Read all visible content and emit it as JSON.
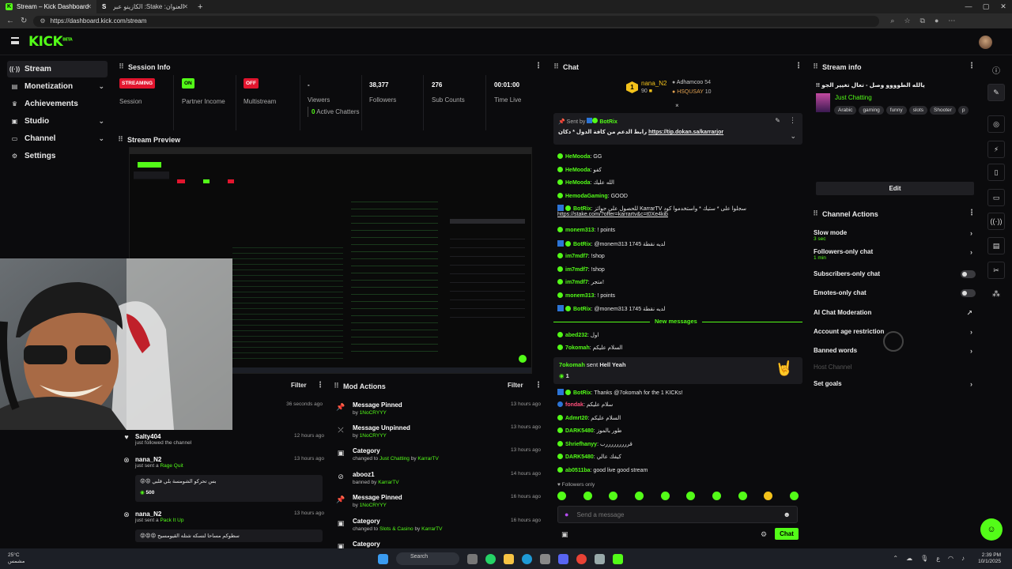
{
  "browser": {
    "tabs": [
      {
        "label": "Stream – Kick Dashboard",
        "active": true
      },
      {
        "label": "العنوان: Stake: الكازينو عبر الإنترنت",
        "active": false
      }
    ],
    "url": "https://dashboard.kick.com/stream"
  },
  "brand": {
    "logo": "KICK",
    "beta": "BETA",
    "accent": "#53fc18"
  },
  "sidebar": {
    "items": [
      {
        "label": "Stream",
        "icon": "broadcast-icon",
        "active": true
      },
      {
        "label": "Monetization",
        "icon": "monetization-icon"
      },
      {
        "label": "Achievements",
        "icon": "trophy-icon"
      },
      {
        "label": "Studio",
        "icon": "studio-icon"
      },
      {
        "label": "Channel",
        "icon": "channel-icon"
      },
      {
        "label": "Settings",
        "icon": "gear-icon"
      }
    ]
  },
  "session": {
    "title": "Session Info",
    "stats": [
      {
        "badge": "STREAMING",
        "label": "Session"
      },
      {
        "badge": "ON",
        "label": "Partner Income"
      },
      {
        "badge": "OFF",
        "label": "Multistream"
      },
      {
        "value": "-",
        "label": "Viewers",
        "extra_count": "0",
        "extra_label": "Active Chatters"
      },
      {
        "value": "38,377",
        "label": "Followers"
      },
      {
        "value": "276",
        "label": "Sub Counts"
      },
      {
        "value": "00:01:00",
        "label": "Time Live"
      }
    ]
  },
  "preview": {
    "title": "Stream Preview"
  },
  "activity": {
    "filter": "Filter",
    "top_time": "36 seconds ago",
    "events": [
      {
        "name": "Salty404",
        "desc": "just followed the channel",
        "time": "12 hours ago"
      },
      {
        "name": "nana_N2",
        "desc": "just sent a",
        "item": "Rage Quit",
        "msg": "بس تحركو الشومسة بلي قلبي 😡😡",
        "amount": "500",
        "time": "13 hours ago"
      },
      {
        "name": "nana_N2",
        "desc": "just sent a",
        "item": "Pack It Up",
        "msg": "سطوكم مساحا لنسكه شتله القيومسيح 😡😡😡",
        "time": "13 hours ago"
      }
    ]
  },
  "mod_actions": {
    "title": "Mod Actions",
    "filter": "Filter",
    "items": [
      {
        "title": "Message Pinned",
        "prefix": "by",
        "by": "1NoCRYYY",
        "time": "13 hours ago",
        "icon": "pin-icon"
      },
      {
        "title": "Message Unpinned",
        "prefix": "by",
        "by": "1NoCRYYY",
        "time": "13 hours ago",
        "icon": "unpin-icon"
      },
      {
        "title": "Category",
        "prefix": "changed to",
        "target": "Just Chatting",
        "by_word": "by",
        "by": "KarrarTV",
        "time": "13 hours ago",
        "icon": "category-icon"
      },
      {
        "title": "abooz1",
        "prefix": "banned by",
        "by": "KarrarTV",
        "time": "14 hours ago",
        "icon": "ban-icon"
      },
      {
        "title": "Message Pinned",
        "prefix": "by",
        "by": "1NoCRYYY",
        "time": "16 hours ago",
        "icon": "pin-icon"
      },
      {
        "title": "Category",
        "prefix": "changed to",
        "target": "Slots & Casino",
        "by_word": "by",
        "by": "KarrarTV",
        "time": "16 hours ago",
        "icon": "category-icon"
      },
      {
        "title": "Category",
        "prefix": "",
        "by": "",
        "time": "",
        "icon": "category-icon"
      }
    ]
  },
  "chat": {
    "title": "Chat",
    "leaders": [
      {
        "name": "nana_N2",
        "count": "90"
      },
      {
        "name": "Adhamcoo",
        "count": "54"
      },
      {
        "name": "HSQUSAY",
        "count": "10"
      }
    ],
    "pinned": {
      "sent_by": "Sent by",
      "user": "BotRix",
      "text": "رابط الدعم من كافة الدول * دكان",
      "link": "https://tip.dokan.sa/karrarjor"
    },
    "messages": [
      {
        "user": "HeMooda",
        "text": "GG",
        "color": "#53fc18"
      },
      {
        "user": "HeMooda",
        "text": "كفو",
        "color": "#53fc18"
      },
      {
        "user": "HeMooda",
        "text": "الله عليك",
        "color": "#53fc18"
      },
      {
        "user": "HemodaGaming",
        "text": "GOOD",
        "color": "#53fc18"
      },
      {
        "user": "BotRix",
        "text": "للحصول على جوائز KarrarTV سجلوا على * ستيك * واستخدموا كود",
        "link": "https://stake.com/?offer=karrartv&c=t0Xe4kib",
        "color": "#53fc18"
      },
      {
        "user": "monem313",
        "text": "! points",
        "color": "#53fc18"
      },
      {
        "user": "BotRix",
        "text": "@monem313 1745 لديه نقطة",
        "color": "#53fc18"
      },
      {
        "user": "im7mdf7",
        "text": "!shop",
        "color": "#53fc18"
      },
      {
        "user": "im7mdf7",
        "text": "!shop",
        "color": "#53fc18"
      },
      {
        "user": "im7mdf7",
        "text": "متجر!",
        "color": "#53fc18"
      },
      {
        "user": "monem313",
        "text": "! points",
        "color": "#53fc18"
      },
      {
        "user": "BotRix",
        "text": "@monem313 1745 لديه نقطة",
        "color": "#53fc18"
      }
    ],
    "new_messages": "New messages",
    "messages2": [
      {
        "user": "abed232",
        "text": "اول",
        "color": "#53fc18"
      },
      {
        "user": "7okomah",
        "text": "السلام عليكم",
        "color": "#53fc18"
      }
    ],
    "gift": {
      "user": "7okomah",
      "sent": "sent",
      "item": "Hell Yeah",
      "count": "1"
    },
    "messages3": [
      {
        "user": "BotRix",
        "text": "Thanks @7okomah for the 1 KICKs!",
        "color": "#53fc18"
      },
      {
        "user": "fondak",
        "text": "سلام عليكم",
        "color": "#ff4f7b"
      },
      {
        "user": "Admrt20",
        "text": "السلام عليكم",
        "color": "#53fc18"
      },
      {
        "user": "DARK5480",
        "text": "طور بالموز",
        "color": "#53fc18"
      },
      {
        "user": "Shriefhanyy",
        "text": "قرررررررررب",
        "color": "#53fc18"
      },
      {
        "user": "DARK5480",
        "text": "كيفك عالي",
        "color": "#53fc18"
      },
      {
        "user": "ab0511ba",
        "text": "good live good stream",
        "color": "#53fc18"
      }
    ],
    "followers_only": "Followers only",
    "input_placeholder": "Send a message",
    "send_label": "Chat"
  },
  "stream_info": {
    "title": "Stream info",
    "stream_title": "!! يالله الطوووو وصل - تعال تغيير الجو",
    "category": "Just Chatting",
    "tags": [
      "Arabic",
      "gaming",
      "funny",
      "slots",
      "Shooter",
      "p"
    ],
    "edit_label": "Edit"
  },
  "channel_actions": {
    "title": "Channel Actions",
    "items": [
      {
        "label": "Slow mode",
        "sub": "3 sec",
        "control": "arrow"
      },
      {
        "label": "Followers-only chat",
        "sub": "1 min",
        "control": "arrow"
      },
      {
        "label": "Subscribers-only chat",
        "control": "toggle"
      },
      {
        "label": "Emotes-only chat",
        "control": "toggle"
      },
      {
        "label": "AI Chat Moderation",
        "control": "external"
      },
      {
        "label": "Account age restriction",
        "control": "arrow"
      },
      {
        "label": "Banned words",
        "control": "arrow"
      },
      {
        "label": "Host Channel",
        "control": "none",
        "disabled": true
      },
      {
        "label": "Set goals",
        "control": "arrow"
      }
    ]
  },
  "taskbar": {
    "weather_temp": "25°C",
    "weather_desc": "مشمس",
    "search": "Search",
    "time": "2:39 PM",
    "date": "10/1/2025",
    "lang": "ع"
  }
}
